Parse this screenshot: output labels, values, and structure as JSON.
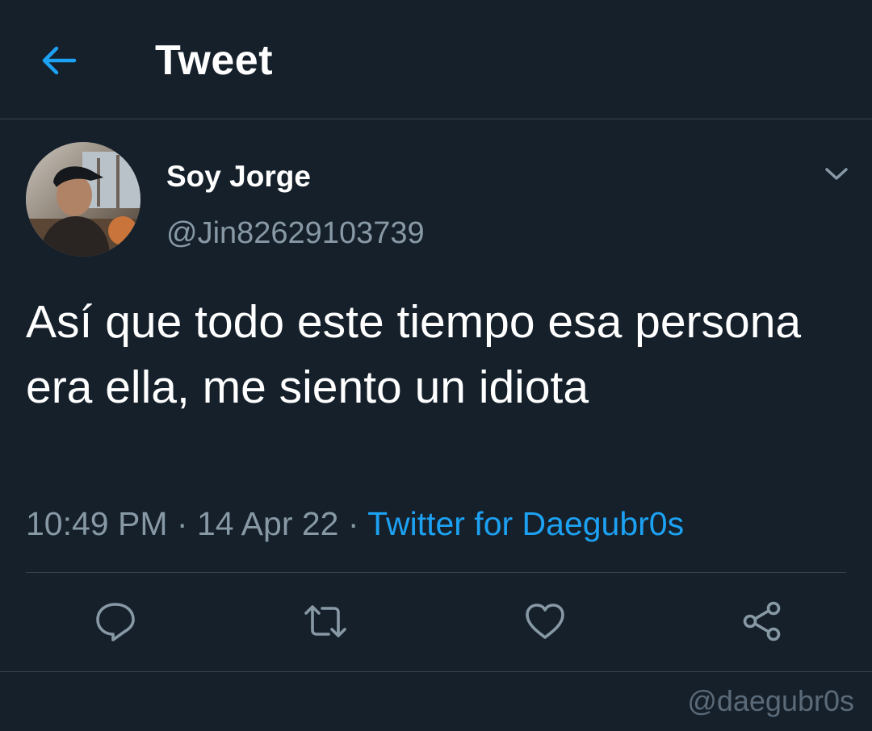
{
  "header": {
    "title": "Tweet",
    "back_icon": "arrow-left-icon",
    "accent_color": "#1da1f2"
  },
  "tweet": {
    "author": {
      "display_name": "Soy Jorge",
      "handle": "@Jin82629103739",
      "avatar_icon": "profile-photo"
    },
    "menu_icon": "chevron-down-icon",
    "text": "Así que todo este tiempo esa persona era ella, me siento un idiota",
    "time": "10:49 PM",
    "separator": " · ",
    "date": "14 Apr 22",
    "source": "Twitter for Daegubr0s"
  },
  "actions": [
    {
      "name": "reply",
      "icon": "speech-bubble-icon"
    },
    {
      "name": "retweet",
      "icon": "retweet-icon"
    },
    {
      "name": "like",
      "icon": "heart-icon"
    },
    {
      "name": "share",
      "icon": "share-icon"
    }
  ],
  "watermark": "@daegubr0s",
  "colors": {
    "background": "#15202b",
    "divider": "#38444d",
    "secondary_text": "#8899a6"
  }
}
